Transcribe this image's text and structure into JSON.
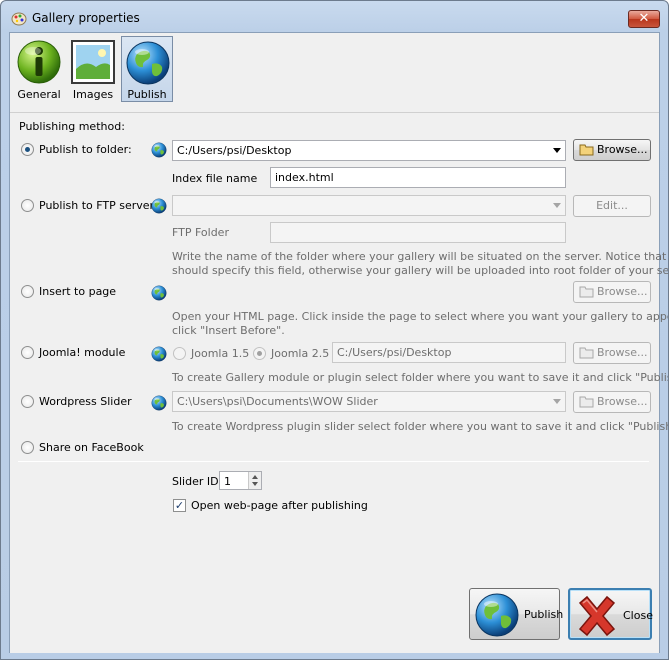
{
  "window": {
    "title": "Gallery properties",
    "close_glyph": "✕"
  },
  "tabs": [
    {
      "label": "General",
      "icon": "info-icon",
      "active": false
    },
    {
      "label": "Images",
      "icon": "picture-icon",
      "active": false
    },
    {
      "label": "Publish",
      "icon": "globe-icon",
      "active": true
    }
  ],
  "form": {
    "method_label": "Publishing method:",
    "folder": {
      "label": "Publish to folder:",
      "selected": true,
      "path": "C:/Users/psi/Desktop",
      "browse": "Browse...",
      "index_label": "Index file name",
      "index_value": "index.html"
    },
    "ftp": {
      "label": "Publish to FTP server",
      "selected": false,
      "server": "",
      "edit": "Edit...",
      "folder_label": "FTP Folder",
      "folder_value": "",
      "hint_1": "Write the name of the folder where your gallery will be situated on the server. Notice that you",
      "hint_2": "should specify this field, otherwise your gallery will be uploaded into root folder of your server!"
    },
    "insert_page": {
      "label": "Insert to page",
      "selected": false,
      "path": "",
      "browse": "Browse...",
      "hint_1": "Open your HTML page. Click inside the page to select where you want your gallery to appear, then",
      "hint_2": "click \"Insert Before\"."
    },
    "joomla": {
      "label": "Joomla! module",
      "selected": false,
      "opt_15": "Joomla 1.5",
      "opt_25": "Joomla 2.5",
      "selected_version": "Joomla 2.5",
      "path": "C:/Users/psi/Desktop",
      "browse": "Browse...",
      "hint": "To create Gallery module or plugin select folder where you want to save it and click \"Publish\" button."
    },
    "wordpress": {
      "label": "Wordpress Slider",
      "selected": false,
      "path": "C:\\Users\\psi\\Documents\\WOW Slider",
      "browse": "Browse...",
      "hint": "To create Wordpress plugin slider select folder where you want to save it and click \"Publish\" button"
    },
    "facebook": {
      "label": "Share on FaceBook",
      "selected": false
    },
    "slider_id_label": "Slider ID",
    "slider_id_value": "1",
    "open_after_label": "Open web-page after publishing",
    "open_after_checked": true
  },
  "buttons": {
    "publish": "Publish",
    "close": "Close"
  },
  "colors": {
    "accent": "#3c7fb1",
    "title_bar": "#c9daee",
    "close_red": "#c8553c"
  }
}
